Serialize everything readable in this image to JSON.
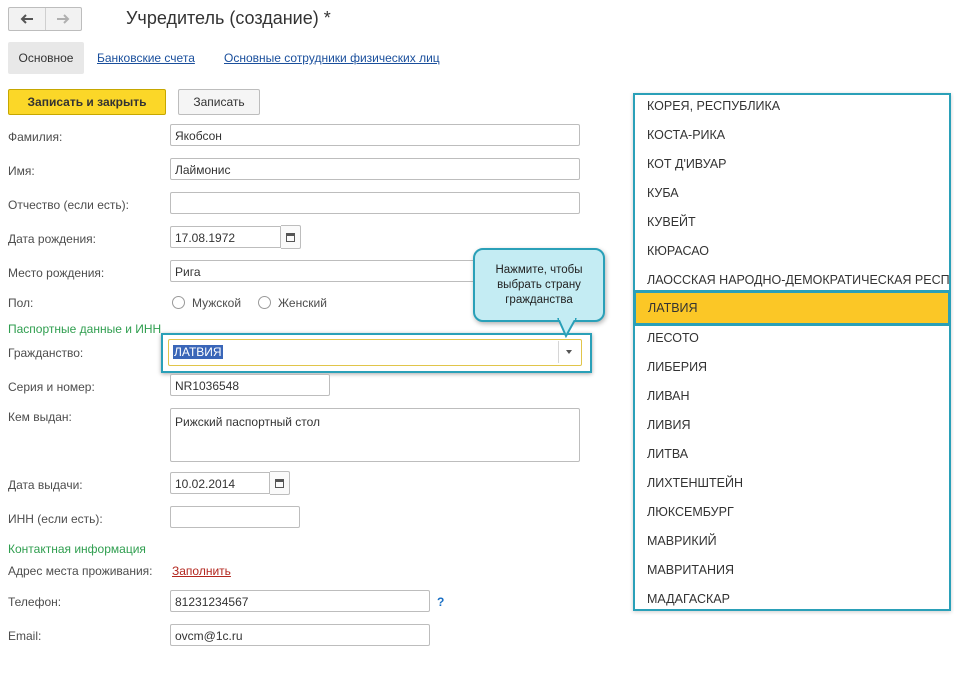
{
  "window": {
    "title": "Учредитель (создание) *",
    "back_icon": "arrow-left-icon",
    "forward_icon": "arrow-right-icon"
  },
  "tabs": [
    {
      "label": "Основное",
      "active": true
    },
    {
      "label": "Банковские счета",
      "active": false
    },
    {
      "label": "Основные сотрудники физических лиц",
      "active": false
    }
  ],
  "toolbar": {
    "save_close_label": "Записать и закрыть",
    "save_label": "Записать",
    "accent": "#fbd728"
  },
  "form": {
    "last_name": {
      "label": "Фамилия:",
      "value": "Якобсон"
    },
    "first_name": {
      "label": "Имя:",
      "value": "Лаймонис"
    },
    "middle_name": {
      "label": "Отчество (если есть):",
      "value": ""
    },
    "birth_date": {
      "label": "Дата рождения:",
      "value": "17.08.1972"
    },
    "birth_place": {
      "label": "Место рождения:",
      "value": "Рига"
    },
    "gender": {
      "label": "Пол:",
      "options": [
        "Мужской",
        "Женский"
      ],
      "selected": ""
    },
    "passport_section": "Паспортные данные и ИНН",
    "citizenship": {
      "label": "Гражданство:",
      "value": "ЛАТВИЯ"
    },
    "passport_number": {
      "label": "Серия и номер:",
      "value": "NR1036548"
    },
    "issued_by": {
      "label": "Кем выдан:",
      "value": "Рижский паспортный стол"
    },
    "issue_date": {
      "label": "Дата выдачи:",
      "value": "10.02.2014"
    },
    "inn": {
      "label": "ИНН (если есть):",
      "value": ""
    },
    "contact_section": "Контактная информация",
    "address": {
      "label": "Адрес места проживания:",
      "link": "Заполнить"
    },
    "phone": {
      "label": "Телефон:",
      "value": "81231234567",
      "help": "?"
    },
    "email": {
      "label": "Email:",
      "value": "ovcm@1c.ru"
    }
  },
  "callout": {
    "text": "Нажмите, чтобы выбрать страну гражданства",
    "color": "#c4ecf3",
    "border_color": "#2aa0b8"
  },
  "country_list": {
    "items": [
      "КОРЕЯ, РЕСПУБЛИКА",
      "КОСТА-РИКА",
      "КОТ Д'ИВУАР",
      "КУБА",
      "КУВЕЙТ",
      "КЮРАСАО",
      "ЛАОССКАЯ НАРОДНО-ДЕМОКРАТИЧЕСКАЯ РЕСПУБЛИКА",
      "ЛАТВИЯ",
      "ЛЕСОТО",
      "ЛИБЕРИЯ",
      "ЛИВАН",
      "ЛИВИЯ",
      "ЛИТВА",
      "ЛИХТЕНШТЕЙН",
      "ЛЮКСЕМБУРГ",
      "МАВРИКИЙ",
      "МАВРИТАНИЯ",
      "МАДАГАСКАР"
    ],
    "selected": "ЛАТВИЯ",
    "highlight_color": "#fbc726"
  }
}
